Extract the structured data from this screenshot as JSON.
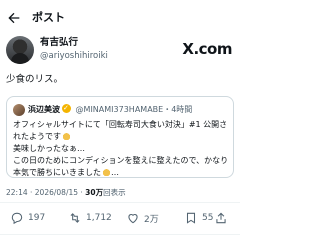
{
  "header": {
    "title": "ポスト"
  },
  "author": {
    "name": "有吉弘行",
    "handle": "@ariyoshihiroiki",
    "platform_logo": "X.com"
  },
  "tweet": {
    "text": "少食のリス。"
  },
  "quote": {
    "name": "浜辺美波",
    "handle": "@MINAMI373HAMABE",
    "age": "4時間",
    "lines": [
      "オフィシャルサイトにて「回転寿司大食い対決」#1 公開されたようです",
      "美味しかったなぁ…",
      "この日のためにコンディションを整えに整えたので、かなり本気で勝ちにいきました",
      "…"
    ]
  },
  "meta": {
    "time": "22:14",
    "date": "2026/08/15",
    "views": "30万",
    "views_label": "回表示"
  },
  "actions": {
    "replies": "197",
    "retweets": "1,712",
    "likes": "2万",
    "bookmarks": "55"
  },
  "icons": [
    "back-arrow-icon",
    "reply-icon",
    "retweet-icon",
    "like-icon",
    "bookmark-icon",
    "share-icon",
    "verified-icon"
  ]
}
